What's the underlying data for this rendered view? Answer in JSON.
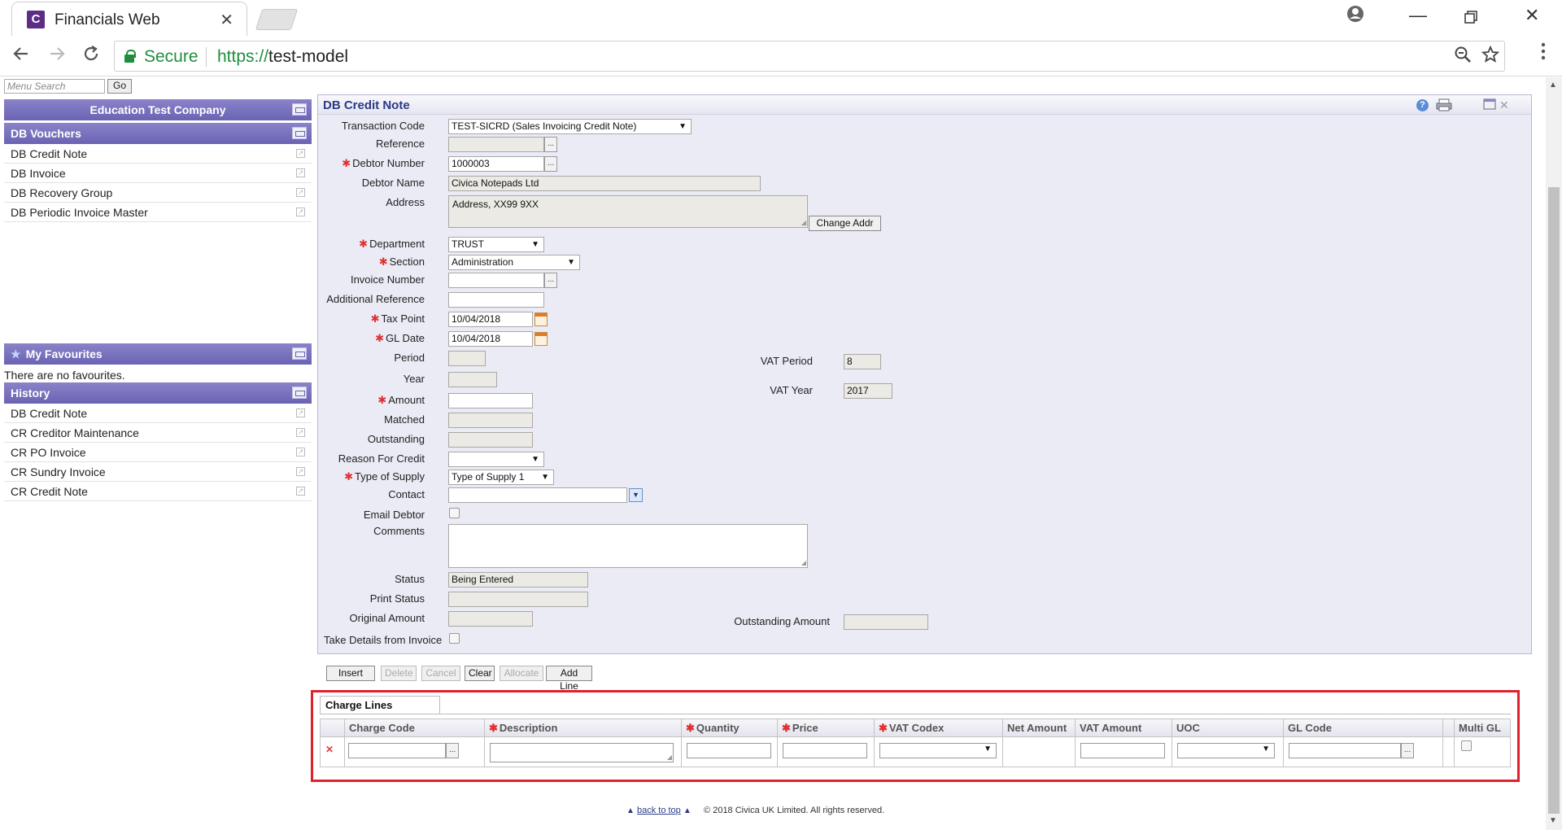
{
  "browser": {
    "tab_title": "Financials Web",
    "tab_favicon": "C",
    "tab_close": "✕",
    "secure_label": "Secure",
    "url_scheme": "https://",
    "url_host": "test-model"
  },
  "sidebar": {
    "search_placeholder": "Menu Search",
    "go_label": "Go",
    "company": "Education Test Company",
    "vouchers_header": "DB Vouchers",
    "vouchers": [
      "DB Credit Note",
      "DB Invoice",
      "DB Recovery Group",
      "DB Periodic Invoice Master"
    ],
    "favourites_header": "My Favourites",
    "favourites_empty": "There are no favourites.",
    "history_header": "History",
    "history": [
      "DB Credit Note",
      "CR Creditor Maintenance",
      "CR PO Invoice",
      "CR Sundry Invoice",
      "CR Credit Note"
    ]
  },
  "form": {
    "title": "DB Credit Note",
    "labels": {
      "transaction_code": "Transaction Code",
      "reference": "Reference",
      "debtor_number": "Debtor Number",
      "debtor_name": "Debtor Name",
      "address": "Address",
      "department": "Department",
      "section": "Section",
      "invoice_number": "Invoice Number",
      "additional_reference": "Additional Reference",
      "tax_point": "Tax Point",
      "gl_date": "GL Date",
      "period": "Period",
      "year": "Year",
      "amount": "Amount",
      "matched": "Matched",
      "outstanding": "Outstanding",
      "reason_for_credit": "Reason For Credit",
      "type_of_supply": "Type of Supply",
      "contact": "Contact",
      "email_debtor": "Email Debtor",
      "comments": "Comments",
      "status": "Status",
      "print_status": "Print Status",
      "original_amount": "Original Amount",
      "take_details": "Take Details from Invoice",
      "vat_period": "VAT Period",
      "vat_year": "VAT Year",
      "outstanding_amount": "Outstanding Amount"
    },
    "values": {
      "transaction_code": "TEST-SICRD (Sales Invoicing Credit Note)",
      "debtor_number": "1000003",
      "debtor_name": "Civica Notepads Ltd",
      "address": "Address, XX99 9XX",
      "department": "TRUST",
      "section": "Administration",
      "tax_point": "10/04/2018",
      "gl_date": "10/04/2018",
      "type_of_supply": "Type of Supply 1",
      "status": "Being Entered",
      "vat_period": "8",
      "vat_year": "2017"
    },
    "change_addr_label": "Change Addr",
    "lookup_glyph": "...",
    "dropdown_glyph": "▼"
  },
  "actions": {
    "insert": "Insert",
    "delete": "Delete",
    "cancel": "Cancel",
    "clear": "Clear",
    "allocate": "Allocate",
    "add_line": "Add Line"
  },
  "charge_lines": {
    "tab_label": "Charge Lines",
    "columns": {
      "charge_code": "Charge Code",
      "description": "Description",
      "quantity": "Quantity",
      "price": "Price",
      "vat_codex": "VAT Codex",
      "net_amount": "Net Amount",
      "vat_amount": "VAT Amount",
      "uoc": "UOC",
      "gl_code": "GL Code",
      "multi_gl": "Multi GL"
    },
    "delete_glyph": "✕"
  },
  "footer": {
    "back_to_top": "back to top",
    "copyright": "© 2018 Civica UK Limited. All rights reserved."
  }
}
